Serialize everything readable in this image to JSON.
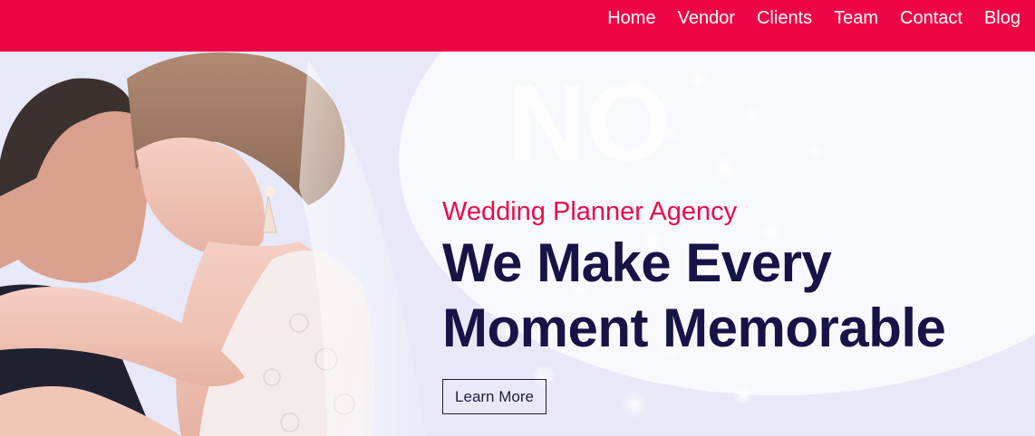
{
  "nav": {
    "items": [
      {
        "label": "Home"
      },
      {
        "label": "Vendor"
      },
      {
        "label": "Clients"
      },
      {
        "label": "Team"
      },
      {
        "label": "Contact"
      },
      {
        "label": "Blog"
      }
    ]
  },
  "hero": {
    "kicker": "Wedding Planner Agency",
    "headline_line1": "We Make Every",
    "headline_line2": "Moment Memorable",
    "cta_label": "Learn More",
    "background_sign_text": "NO"
  },
  "colors": {
    "topbar": "#ef0546",
    "kicker": "#ea0a4b",
    "headline": "#161446",
    "button_border": "#1e1d3f"
  }
}
